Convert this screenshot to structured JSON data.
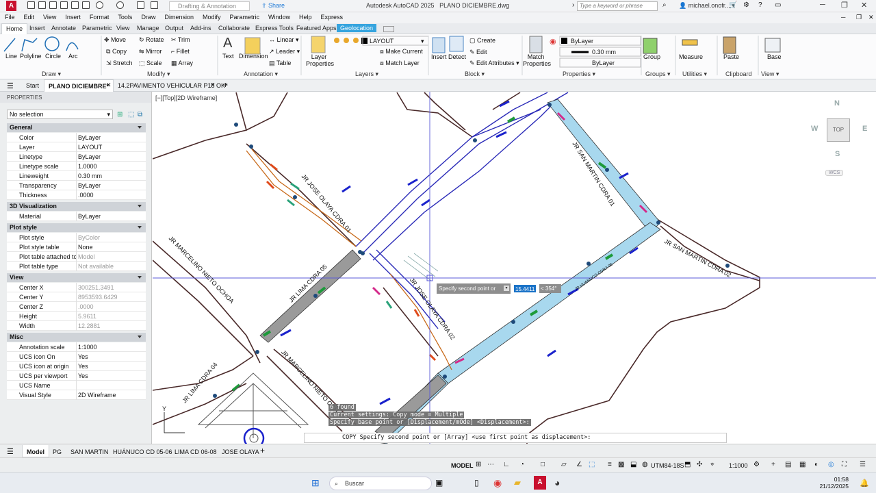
{
  "app": {
    "title": "Autodesk AutoCAD 2025",
    "file": "PLANO DICIEMBRE.dwg",
    "workspace": "Drafting & Annotation",
    "share": "Share",
    "search_placeholder": "Type a keyword or phrase",
    "user": "michael.onofr..."
  },
  "menu": [
    "File",
    "Edit",
    "View",
    "Insert",
    "Format",
    "Tools",
    "Draw",
    "Dimension",
    "Modify",
    "Parametric",
    "Window",
    "Help",
    "Express"
  ],
  "ribbon_tabs": [
    "Home",
    "Insert",
    "Annotate",
    "Parametric",
    "View",
    "Manage",
    "Output",
    "Add-ins",
    "Collaborate",
    "Express Tools",
    "Featured Apps",
    "Geolocation"
  ],
  "ribbon": {
    "draw": {
      "label": "Draw",
      "line": "Line",
      "polyline": "Polyline",
      "circle": "Circle",
      "arc": "Arc"
    },
    "modify": {
      "label": "Modify",
      "move": "Move",
      "rotate": "Rotate",
      "trim": "Trim",
      "copy": "Copy",
      "mirror": "Mirror",
      "fillet": "Fillet",
      "stretch": "Stretch",
      "scale": "Scale",
      "array": "Array"
    },
    "annotation": {
      "label": "Annotation",
      "text": "Text",
      "dimension": "Dimension",
      "linear": "Linear",
      "leader": "Leader",
      "table": "Table"
    },
    "layers": {
      "label": "Layers",
      "layer_props": "Layer Properties",
      "current_layer": "LAYOUT",
      "make_current": "Make Current",
      "match_layer": "Match Layer"
    },
    "block": {
      "label": "Block",
      "insert": "Insert",
      "detect": "Detect",
      "create": "Create",
      "edit": "Edit",
      "edit_attributes": "Edit Attributes"
    },
    "properties": {
      "label": "Properties",
      "match": "Match Properties",
      "color": "ByLayer",
      "lineweight": "0.30 mm",
      "linetype": "ByLayer"
    },
    "groups": {
      "label": "Groups",
      "group": "Group"
    },
    "utilities": {
      "label": "Utilities",
      "measure": "Measure"
    },
    "clipboard": {
      "label": "Clipboard",
      "paste": "Paste"
    },
    "view": {
      "label": "View",
      "base": "Base"
    }
  },
  "doc_tabs": [
    "Start",
    "PLANO DICIEMBRE*",
    "14.2PAVIMENTO VEHICULAR P18 OK*"
  ],
  "properties": {
    "title": "PROPERTIES",
    "selection": "No selection",
    "sections": [
      {
        "name": "General",
        "rows": [
          [
            "Color",
            "ByLayer"
          ],
          [
            "Layer",
            "LAYOUT"
          ],
          [
            "Linetype",
            "ByLayer"
          ],
          [
            "Linetype scale",
            "1.0000"
          ],
          [
            "Lineweight",
            "0.30 mm"
          ],
          [
            "Transparency",
            "ByLayer"
          ],
          [
            "Thickness",
            ".0000"
          ]
        ]
      },
      {
        "name": "3D Visualization",
        "rows": [
          [
            "Material",
            "ByLayer"
          ]
        ]
      },
      {
        "name": "Plot style",
        "rows": [
          [
            "Plot style",
            "ByColor"
          ],
          [
            "Plot style table",
            "None"
          ],
          [
            "Plot table attached to",
            "Model"
          ],
          [
            "Plot table type",
            "Not available"
          ]
        ]
      },
      {
        "name": "View",
        "rows": [
          [
            "Center X",
            "300251.3491"
          ],
          [
            "Center Y",
            "8953593.6429"
          ],
          [
            "Center Z",
            ".0000"
          ],
          [
            "Height",
            "5.9611"
          ],
          [
            "Width",
            "12.2881"
          ]
        ]
      },
      {
        "name": "Misc",
        "rows": [
          [
            "Annotation scale",
            "1:1000"
          ],
          [
            "UCS icon On",
            "Yes"
          ],
          [
            "UCS icon at origin",
            "Yes"
          ],
          [
            "UCS per viewport",
            "Yes"
          ],
          [
            "UCS Name",
            ""
          ],
          [
            "Visual Style",
            "2D Wireframe"
          ]
        ]
      }
    ]
  },
  "canvas": {
    "view_label": "[−][Top][2D Wireframe]",
    "streets": [
      "JR JOSE OLAYA CDRA 01",
      "JR SAN MARTIN CDRA 01",
      "JR SAN MARTIN CDRA 02",
      "JR MARCELINO NIETO OCHOA",
      "JR LIMA CDRA 05",
      "JR JOSE OLAYA CDRA 02",
      "JR HUANUCO CDRA 06",
      "JR LIMA CDRA 04",
      "JR MARCELINO NIETO OCH"
    ],
    "dynamic_prompt": "Specify second point or",
    "dynamic_value": "15.4411",
    "dynamic_angle": "< 354°",
    "viewcube": {
      "n": "N",
      "s": "S",
      "e": "E",
      "w": "W",
      "top": "TOP",
      "wcs": "WCS"
    }
  },
  "command": {
    "history": [
      "6 found",
      "Current settings:  Copy mode = Multiple",
      "Specify base point or [Displacement/mOde] <Displacement>:"
    ],
    "current": "COPY Specify second point or [Array] <use first point as displacement>:"
  },
  "layout_tabs": [
    "Model",
    "PG",
    "SAN MARTIN",
    "HUÁNUCO CD 05-06",
    "LIMA CD 06-08",
    "JOSE OLAYA"
  ],
  "status": {
    "model": "MODEL",
    "coord": "UTM84-18S",
    "scale": "1:1000"
  },
  "taskbar": {
    "search": "Buscar",
    "time": "01:58",
    "date": "21/12/2025"
  }
}
